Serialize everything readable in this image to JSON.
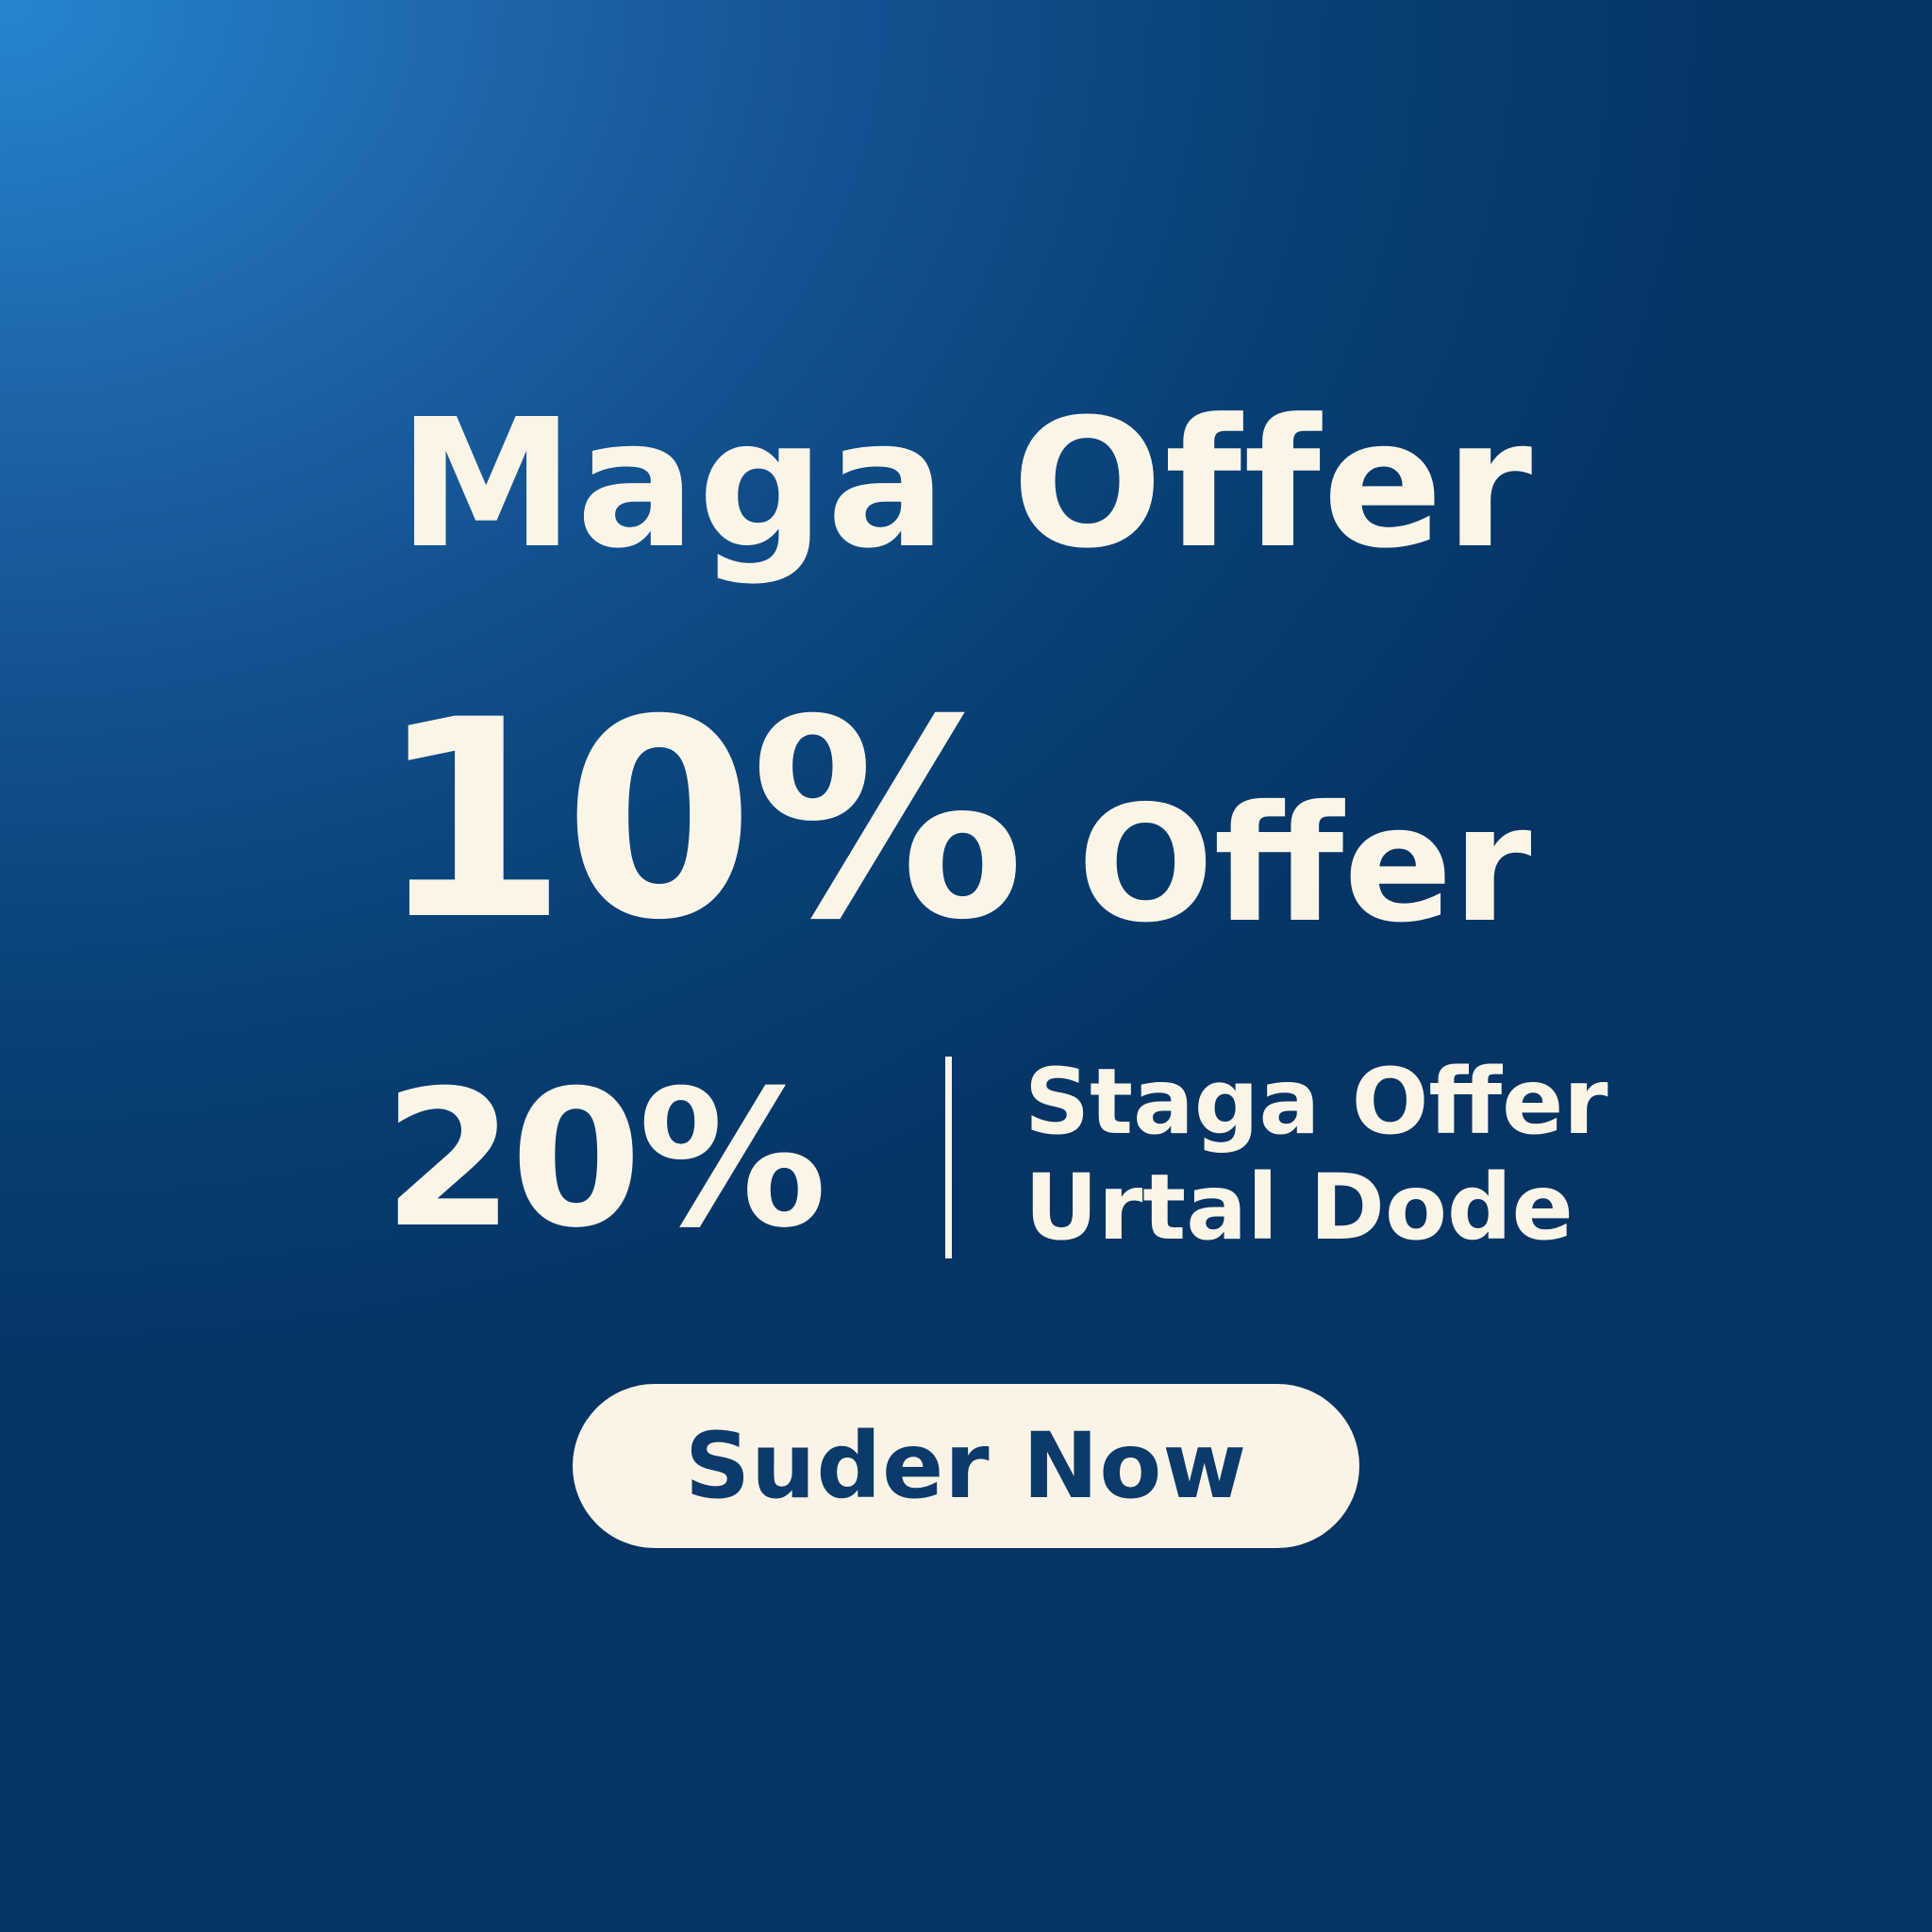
{
  "banner": {
    "headline": "Maga Offer",
    "main_offer": {
      "percent": "10%",
      "label": "Offer"
    },
    "secondary_offer": {
      "percent": "20%",
      "line1": "Staga Offer",
      "line2": "Urtal Dode"
    },
    "cta_label": "Suder Now"
  },
  "colors": {
    "background_light": "#2585D1",
    "background_dark": "#063464",
    "text": "#FBF5E8",
    "button_bg": "#FBF4E6",
    "button_text": "#0C3A6A"
  }
}
